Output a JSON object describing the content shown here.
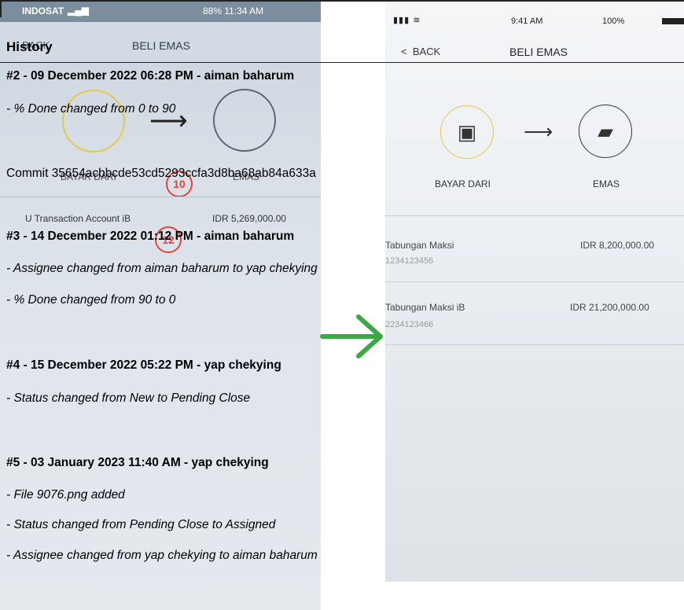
{
  "history": {
    "title": "History",
    "journals": [
      {
        "header": "#2 - 09 December 2022 06:28 PM - aiman baharum",
        "details": [
          "- % Done changed from 0 to 90"
        ],
        "commit": "Commit 35654acbbcde53cd5293ccfa3d8ba68ab84a633a"
      },
      {
        "header": "#3 - 14 December 2022 01:12 PM - aiman baharum",
        "details": [
          "- Assignee changed from aiman baharum to yap chekying",
          "- % Done changed from 90 to 0"
        ]
      },
      {
        "header": "#4 - 15 December 2022 05:22 PM - yap chekying",
        "details": [
          "- Status changed from New to Pending Close"
        ]
      },
      {
        "header": "#5 - 03 January 2023 11:40 AM - yap chekying",
        "details": [
          "- File 9076.png added",
          "- Status changed from Pending Close to Assigned",
          "- Assignee changed from yap chekying to aiman baharum"
        ]
      }
    ]
  },
  "left_screenshot": {
    "status": {
      "carrier": "INDOSAT",
      "right": "88% 11:34 AM"
    },
    "header": {
      "back": "BACK",
      "title": "BELI EMAS"
    },
    "labels": {
      "from": "BAYAR DARI",
      "to": "EMAS"
    },
    "badges": [
      "10",
      "12"
    ],
    "account": {
      "name": "U Transaction Account iB",
      "amount": "IDR 5,269,000.00"
    },
    "colors": {
      "ring": "#e4c84a",
      "badge": "#e0443d"
    }
  },
  "right_screenshot": {
    "status": {
      "time": "9:41 AM",
      "battery": "100%"
    },
    "header": {
      "back": "BACK",
      "title": "BELI EMAS"
    },
    "labels": {
      "from": "BAYAR DARI",
      "to": "EMAS"
    },
    "accounts": [
      {
        "name": "Tabungan Maksi",
        "number": "1234123456",
        "amount": "IDR 8,200,000.00"
      },
      {
        "name": "Tabungan Maksi iB",
        "number": "2234123466",
        "amount": "IDR 21,200,000.00"
      }
    ]
  },
  "arrow": {
    "color": "#3aa845"
  }
}
